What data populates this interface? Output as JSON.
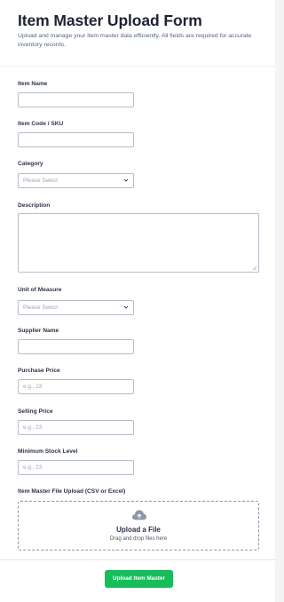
{
  "header": {
    "title": "Item Master Upload Form",
    "subtitle": "Upload and manage your item master data efficiently. All fields are required for accurate inventory records."
  },
  "fields": {
    "item_name": {
      "label": "Item Name",
      "value": ""
    },
    "item_code": {
      "label": "Item Code / SKU",
      "value": ""
    },
    "category": {
      "label": "Category",
      "placeholder": "Please Select"
    },
    "description": {
      "label": "Description",
      "value": ""
    },
    "unit_of_measure": {
      "label": "Unit of Measure",
      "placeholder": "Please Select"
    },
    "supplier_name": {
      "label": "Supplier Name",
      "value": ""
    },
    "purchase_price": {
      "label": "Purchase Price",
      "placeholder": "e.g., 23"
    },
    "selling_price": {
      "label": "Selling Price",
      "placeholder": "e.g., 23"
    },
    "min_stock": {
      "label": "Minimum Stock Level",
      "placeholder": "e.g., 23"
    },
    "file_upload": {
      "label": "Item Master File Upload (CSV or Excel)",
      "title": "Upload a File",
      "subtitle": "Drag and drop files here",
      "icon": "cloud-upload-icon"
    }
  },
  "submit": {
    "label": "Upload Item Master",
    "color": "#18bd5b"
  },
  "colors": {
    "border": "#b8bdc9",
    "text": "#2c3345",
    "placeholder": "#a0a6b6"
  }
}
